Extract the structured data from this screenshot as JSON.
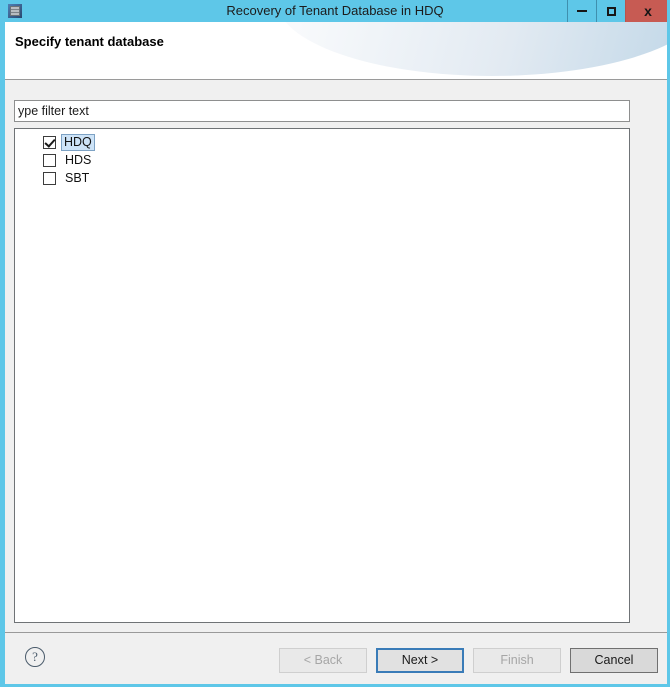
{
  "window": {
    "title": "Recovery of Tenant Database in HDQ",
    "icon": "database-window-icon",
    "controls": {
      "minimize": "minimize-icon",
      "maximize": "maximize-icon",
      "close": "x"
    },
    "accent_color": "#5ec7e8",
    "close_color": "#c75b53"
  },
  "header": {
    "title": "Specify tenant database"
  },
  "filter": {
    "value": "ype filter text",
    "placeholder": "type filter text"
  },
  "list": {
    "items": [
      {
        "label": "HDQ",
        "checked": true,
        "selected": true
      },
      {
        "label": "HDS",
        "checked": false,
        "selected": false
      },
      {
        "label": "SBT",
        "checked": false,
        "selected": false
      }
    ]
  },
  "footer": {
    "help": "?",
    "buttons": [
      {
        "label": "< Back",
        "state": "disabled"
      },
      {
        "label": "Next >",
        "state": "default"
      },
      {
        "label": "Finish",
        "state": "disabled"
      },
      {
        "label": "Cancel",
        "state": "normal"
      }
    ]
  }
}
